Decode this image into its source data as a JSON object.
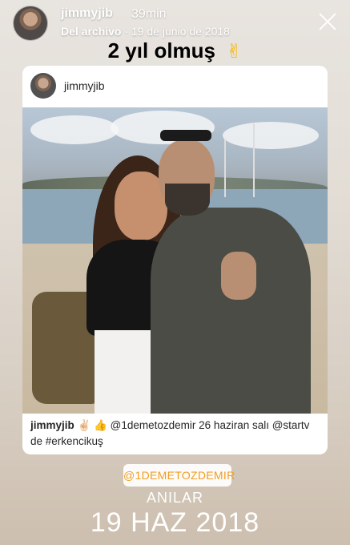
{
  "story": {
    "username": "jimmyjib",
    "time_ago": "39min",
    "archive_label": "Del archivo",
    "archive_date": "19 de junio de 2018",
    "close_icon": "close-icon",
    "headline": "2 yıl olmuş",
    "headline_emoji": "✌"
  },
  "post": {
    "username": "jimmyjib",
    "caption_user": "jimmyjib",
    "caption_emoji": "✌🏻 👍",
    "caption_text": "@1demetozdemir 26 haziran salı @startv de #erkencikuş"
  },
  "footer": {
    "mention": "@1DEMETOZDEMIR",
    "memories_label": "ANILAR",
    "memories_date": "19 HAZ 2018"
  }
}
